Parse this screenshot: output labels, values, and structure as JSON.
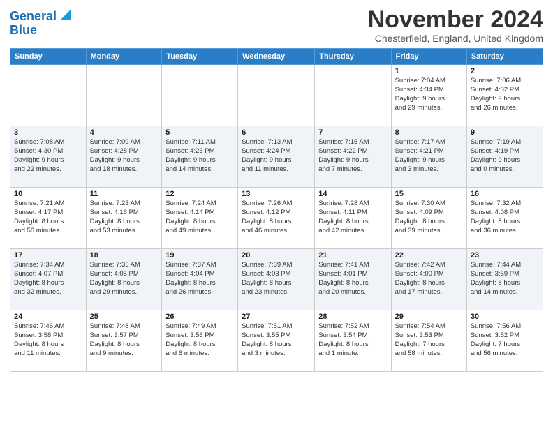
{
  "header": {
    "logo_line1": "General",
    "logo_line2": "Blue",
    "month_title": "November 2024",
    "location": "Chesterfield, England, United Kingdom"
  },
  "weekdays": [
    "Sunday",
    "Monday",
    "Tuesday",
    "Wednesday",
    "Thursday",
    "Friday",
    "Saturday"
  ],
  "weeks": [
    [
      {
        "day": "",
        "info": ""
      },
      {
        "day": "",
        "info": ""
      },
      {
        "day": "",
        "info": ""
      },
      {
        "day": "",
        "info": ""
      },
      {
        "day": "",
        "info": ""
      },
      {
        "day": "1",
        "info": "Sunrise: 7:04 AM\nSunset: 4:34 PM\nDaylight: 9 hours\nand 29 minutes."
      },
      {
        "day": "2",
        "info": "Sunrise: 7:06 AM\nSunset: 4:32 PM\nDaylight: 9 hours\nand 26 minutes."
      }
    ],
    [
      {
        "day": "3",
        "info": "Sunrise: 7:08 AM\nSunset: 4:30 PM\nDaylight: 9 hours\nand 22 minutes."
      },
      {
        "day": "4",
        "info": "Sunrise: 7:09 AM\nSunset: 4:28 PM\nDaylight: 9 hours\nand 18 minutes."
      },
      {
        "day": "5",
        "info": "Sunrise: 7:11 AM\nSunset: 4:26 PM\nDaylight: 9 hours\nand 14 minutes."
      },
      {
        "day": "6",
        "info": "Sunrise: 7:13 AM\nSunset: 4:24 PM\nDaylight: 9 hours\nand 11 minutes."
      },
      {
        "day": "7",
        "info": "Sunrise: 7:15 AM\nSunset: 4:22 PM\nDaylight: 9 hours\nand 7 minutes."
      },
      {
        "day": "8",
        "info": "Sunrise: 7:17 AM\nSunset: 4:21 PM\nDaylight: 9 hours\nand 3 minutes."
      },
      {
        "day": "9",
        "info": "Sunrise: 7:19 AM\nSunset: 4:19 PM\nDaylight: 9 hours\nand 0 minutes."
      }
    ],
    [
      {
        "day": "10",
        "info": "Sunrise: 7:21 AM\nSunset: 4:17 PM\nDaylight: 8 hours\nand 56 minutes."
      },
      {
        "day": "11",
        "info": "Sunrise: 7:23 AM\nSunset: 4:16 PM\nDaylight: 8 hours\nand 53 minutes."
      },
      {
        "day": "12",
        "info": "Sunrise: 7:24 AM\nSunset: 4:14 PM\nDaylight: 8 hours\nand 49 minutes."
      },
      {
        "day": "13",
        "info": "Sunrise: 7:26 AM\nSunset: 4:12 PM\nDaylight: 8 hours\nand 46 minutes."
      },
      {
        "day": "14",
        "info": "Sunrise: 7:28 AM\nSunset: 4:11 PM\nDaylight: 8 hours\nand 42 minutes."
      },
      {
        "day": "15",
        "info": "Sunrise: 7:30 AM\nSunset: 4:09 PM\nDaylight: 8 hours\nand 39 minutes."
      },
      {
        "day": "16",
        "info": "Sunrise: 7:32 AM\nSunset: 4:08 PM\nDaylight: 8 hours\nand 36 minutes."
      }
    ],
    [
      {
        "day": "17",
        "info": "Sunrise: 7:34 AM\nSunset: 4:07 PM\nDaylight: 8 hours\nand 32 minutes."
      },
      {
        "day": "18",
        "info": "Sunrise: 7:35 AM\nSunset: 4:05 PM\nDaylight: 8 hours\nand 29 minutes."
      },
      {
        "day": "19",
        "info": "Sunrise: 7:37 AM\nSunset: 4:04 PM\nDaylight: 8 hours\nand 26 minutes."
      },
      {
        "day": "20",
        "info": "Sunrise: 7:39 AM\nSunset: 4:03 PM\nDaylight: 8 hours\nand 23 minutes."
      },
      {
        "day": "21",
        "info": "Sunrise: 7:41 AM\nSunset: 4:01 PM\nDaylight: 8 hours\nand 20 minutes."
      },
      {
        "day": "22",
        "info": "Sunrise: 7:42 AM\nSunset: 4:00 PM\nDaylight: 8 hours\nand 17 minutes."
      },
      {
        "day": "23",
        "info": "Sunrise: 7:44 AM\nSunset: 3:59 PM\nDaylight: 8 hours\nand 14 minutes."
      }
    ],
    [
      {
        "day": "24",
        "info": "Sunrise: 7:46 AM\nSunset: 3:58 PM\nDaylight: 8 hours\nand 11 minutes."
      },
      {
        "day": "25",
        "info": "Sunrise: 7:48 AM\nSunset: 3:57 PM\nDaylight: 8 hours\nand 9 minutes."
      },
      {
        "day": "26",
        "info": "Sunrise: 7:49 AM\nSunset: 3:56 PM\nDaylight: 8 hours\nand 6 minutes."
      },
      {
        "day": "27",
        "info": "Sunrise: 7:51 AM\nSunset: 3:55 PM\nDaylight: 8 hours\nand 3 minutes."
      },
      {
        "day": "28",
        "info": "Sunrise: 7:52 AM\nSunset: 3:54 PM\nDaylight: 8 hours\nand 1 minute."
      },
      {
        "day": "29",
        "info": "Sunrise: 7:54 AM\nSunset: 3:53 PM\nDaylight: 7 hours\nand 58 minutes."
      },
      {
        "day": "30",
        "info": "Sunrise: 7:56 AM\nSunset: 3:52 PM\nDaylight: 7 hours\nand 56 minutes."
      }
    ]
  ]
}
